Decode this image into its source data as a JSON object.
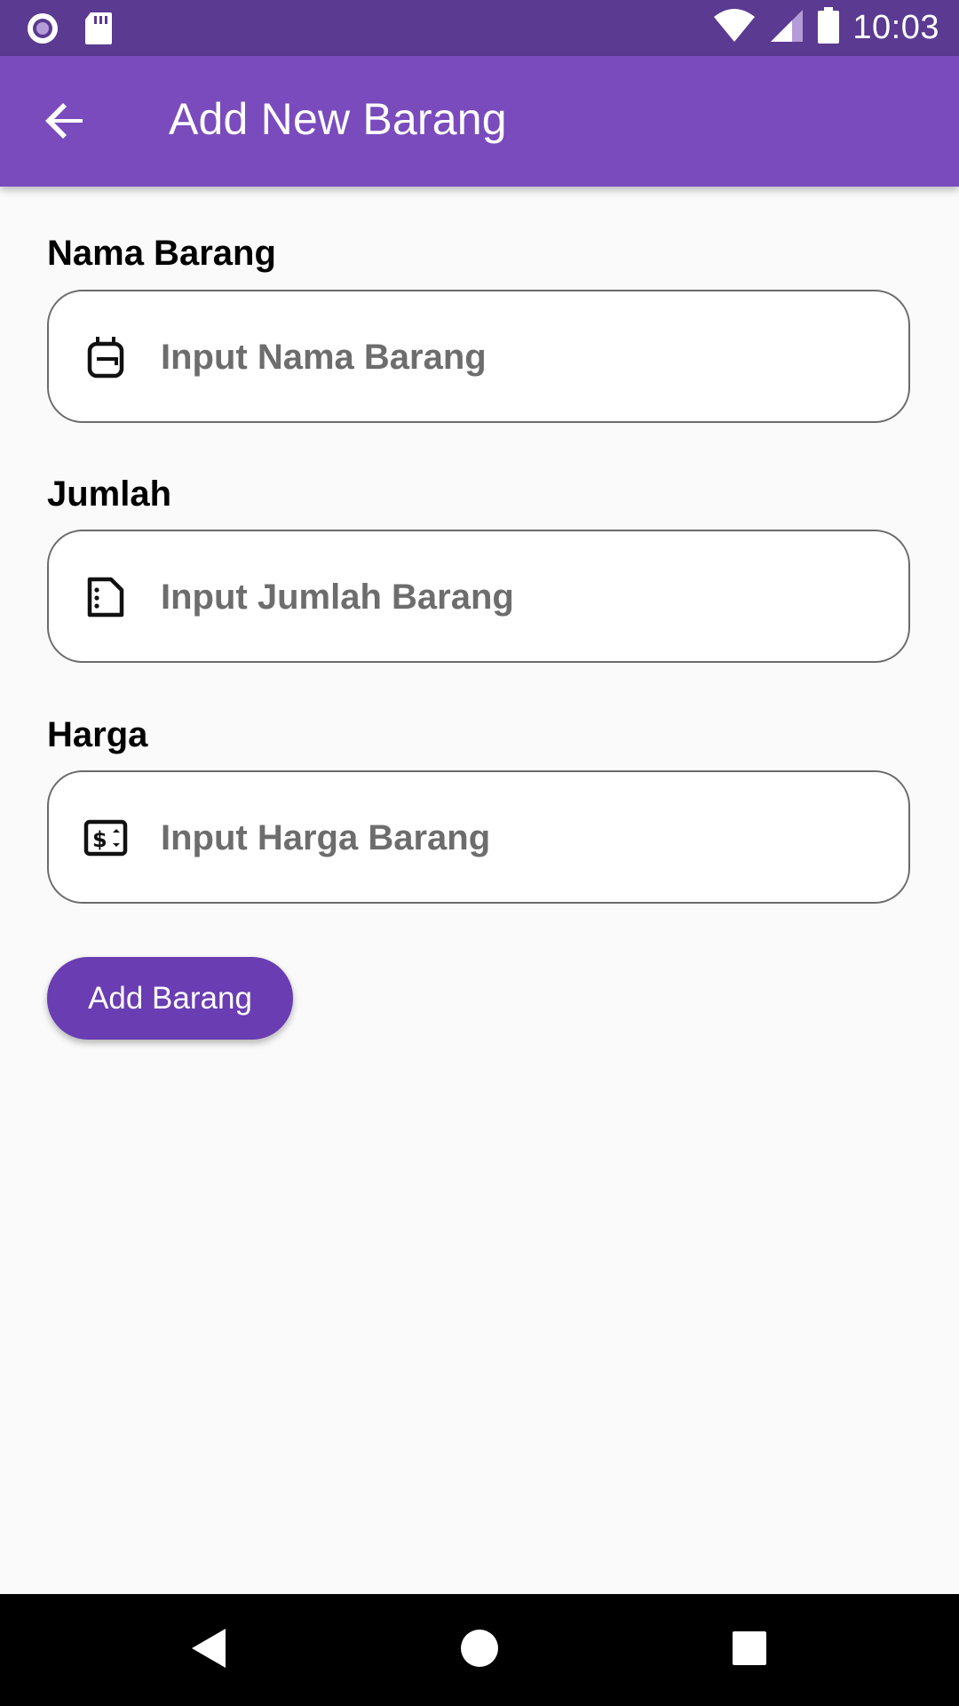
{
  "status_bar": {
    "time": "10:03",
    "icons": [
      "record-icon",
      "sd-card-icon",
      "wifi-icon",
      "signal-icon",
      "battery-icon"
    ]
  },
  "app_bar": {
    "title": "Add New Barang",
    "back_icon": "arrow-back-icon",
    "color": "#7a4bbd"
  },
  "form": {
    "fields": [
      {
        "label": "Nama Barang",
        "placeholder": "Input Nama Barang",
        "value": "",
        "icon": "backpack-icon"
      },
      {
        "label": "Jumlah",
        "placeholder": "Input Jumlah Barang",
        "value": "",
        "icon": "document-icon"
      },
      {
        "label": "Harga",
        "placeholder": "Input Harga Barang",
        "value": "",
        "icon": "price-tag-icon"
      }
    ],
    "submit_label": "Add Barang",
    "submit_color": "#6a3db3"
  },
  "nav_bar": {
    "buttons": [
      "back-triangle-icon",
      "home-circle-icon",
      "recents-square-icon"
    ]
  }
}
